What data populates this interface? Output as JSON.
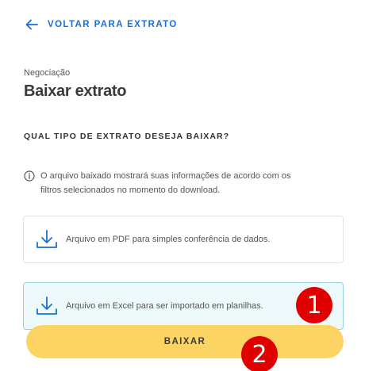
{
  "header": {
    "back_label": "VOLTAR PARA EXTRATO"
  },
  "page": {
    "eyebrow": "Negociação",
    "title": "Baixar extrato"
  },
  "section": {
    "question": "QUAL TIPO DE EXTRATO DESEJA BAIXAR?",
    "info_line1": "O arquivo baixado mostrará suas informações de acordo com os",
    "info_line2": "filtros selecionados no momento do download."
  },
  "options": [
    {
      "label": "Arquivo em PDF para simples conferência de dados.",
      "selected": false
    },
    {
      "label": "Arquivo em Excel para ser importado em planilhas.",
      "selected": true
    }
  ],
  "actions": {
    "download_label": "BAIXAR"
  },
  "badges": [
    "1",
    "2"
  ],
  "colors": {
    "accent": "#1a6fd6",
    "button": "#fcd463",
    "selected_bg": "#eef9fb",
    "badge": "#e00000"
  },
  "icons": {
    "back": "arrow-left-icon",
    "info": "info-circle-icon",
    "download": "download-icon"
  }
}
